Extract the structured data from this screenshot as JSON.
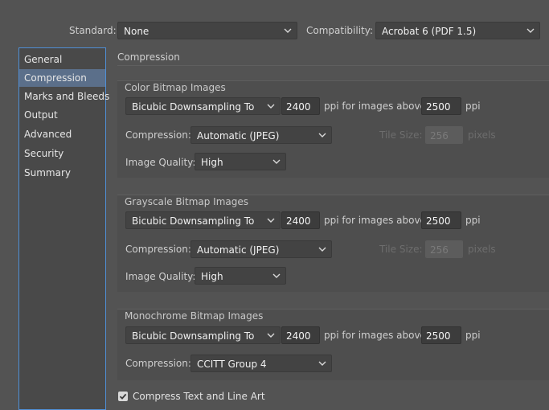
{
  "header": {
    "standard_label": "Standard:",
    "standard_value": "None",
    "compatibility_label": "Compatibility:",
    "compatibility_value": "Acrobat 6 (PDF 1.5)"
  },
  "sidebar": {
    "items": [
      {
        "label": "General"
      },
      {
        "label": "Compression"
      },
      {
        "label": "Marks and Bleeds"
      },
      {
        "label": "Output"
      },
      {
        "label": "Advanced"
      },
      {
        "label": "Security"
      },
      {
        "label": "Summary"
      }
    ],
    "selected": "Compression"
  },
  "main": {
    "section_title": "Compression",
    "color": {
      "title": "Color Bitmap Images",
      "downsampling": "Bicubic Downsampling To",
      "ppi_value": "2400",
      "ppi_above_label": "ppi for images above",
      "ppi_above_value": "2500",
      "ppi_unit": "ppi",
      "compression_label": "Compression:",
      "compression_value": "Automatic (JPEG)",
      "tile_size_label": "Tile Size:",
      "tile_size_value": "256",
      "tile_unit": "pixels",
      "quality_label": "Image Quality:",
      "quality_value": "High"
    },
    "grayscale": {
      "title": "Grayscale Bitmap Images",
      "downsampling": "Bicubic Downsampling To",
      "ppi_value": "2400",
      "ppi_above_label": "ppi for images above",
      "ppi_above_value": "2500",
      "ppi_unit": "ppi",
      "compression_label": "Compression:",
      "compression_value": "Automatic (JPEG)",
      "tile_size_label": "Tile Size:",
      "tile_size_value": "256",
      "tile_unit": "pixels",
      "quality_label": "Image Quality:",
      "quality_value": "High"
    },
    "monochrome": {
      "title": "Monochrome Bitmap Images",
      "downsampling": "Bicubic Downsampling To",
      "ppi_value": "2400",
      "ppi_above_label": "ppi for images above",
      "ppi_above_value": "2500",
      "ppi_unit": "ppi",
      "compression_label": "Compression:",
      "compression_value": "CCITT Group 4"
    },
    "compress_text": {
      "label": "Compress Text and Line Art",
      "checked": true
    }
  }
}
